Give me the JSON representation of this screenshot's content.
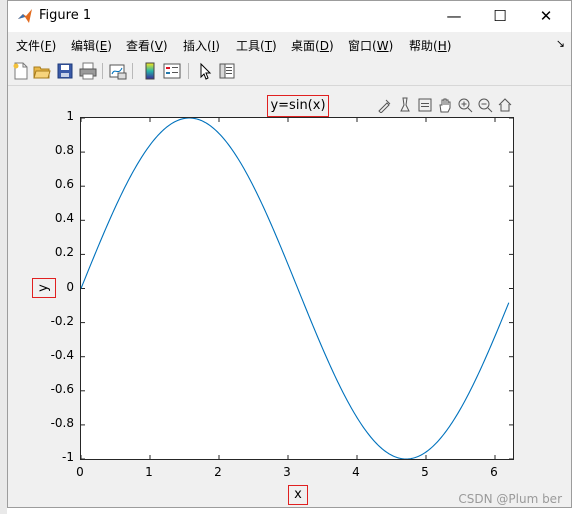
{
  "window": {
    "title": "Figure 1",
    "controls": {
      "minimize": "—",
      "maximize": "☐",
      "close": "✕"
    }
  },
  "menu": [
    {
      "label": "文件",
      "key": "F"
    },
    {
      "label": "编辑",
      "key": "E"
    },
    {
      "label": "查看",
      "key": "V"
    },
    {
      "label": "插入",
      "key": "I"
    },
    {
      "label": "工具",
      "key": "T"
    },
    {
      "label": "桌面",
      "key": "D"
    },
    {
      "label": "窗口",
      "key": "W"
    },
    {
      "label": "帮助",
      "key": "H"
    }
  ],
  "toolbar_icons": [
    "new-figure-icon",
    "open-file-icon",
    "save-icon",
    "print-icon",
    "link-plot-icon",
    "insert-colorbar-icon",
    "insert-legend-icon",
    "edit-plot-icon",
    "property-inspector-icon"
  ],
  "axes_toolbar_icons": [
    "brush-icon",
    "data-tips-icon",
    "restore-view-icon",
    "pan-icon",
    "zoom-in-icon",
    "zoom-out-icon",
    "home-icon"
  ],
  "chart_data": {
    "type": "line",
    "title": "y=sin(x)",
    "xlabel": "x",
    "ylabel": "y",
    "xlim": [
      0,
      6.3
    ],
    "ylim": [
      -1,
      1
    ],
    "x_ticks": [
      "0",
      "1",
      "2",
      "3",
      "4",
      "5",
      "6"
    ],
    "y_ticks": [
      "1",
      "0.8",
      "0.6",
      "0.4",
      "0.2",
      "0",
      "-0.2",
      "-0.4",
      "-0.6",
      "-0.8",
      "-1"
    ],
    "grid": false,
    "series": [
      {
        "color": "#0072bd",
        "x": [
          0,
          0.2,
          0.4,
          0.6,
          0.8,
          1.0,
          1.2,
          1.4,
          1.6,
          1.8,
          2.0,
          2.2,
          2.4,
          2.6,
          2.8,
          3.0,
          3.2,
          3.4,
          3.6,
          3.8,
          4.0,
          4.2,
          4.4,
          4.6,
          4.8,
          5.0,
          5.2,
          5.4,
          5.6,
          5.8,
          6.0,
          6.2
        ],
        "y": [
          0,
          0.199,
          0.389,
          0.565,
          0.717,
          0.841,
          0.932,
          0.985,
          1.0,
          0.974,
          0.909,
          0.808,
          0.675,
          0.516,
          0.335,
          0.141,
          -0.058,
          -0.256,
          -0.443,
          -0.612,
          -0.757,
          -0.872,
          -0.952,
          -0.994,
          -0.996,
          -0.959,
          -0.883,
          -0.773,
          -0.631,
          -0.465,
          -0.279,
          -0.083
        ]
      }
    ]
  },
  "watermark": "CSDN @Plum ber"
}
